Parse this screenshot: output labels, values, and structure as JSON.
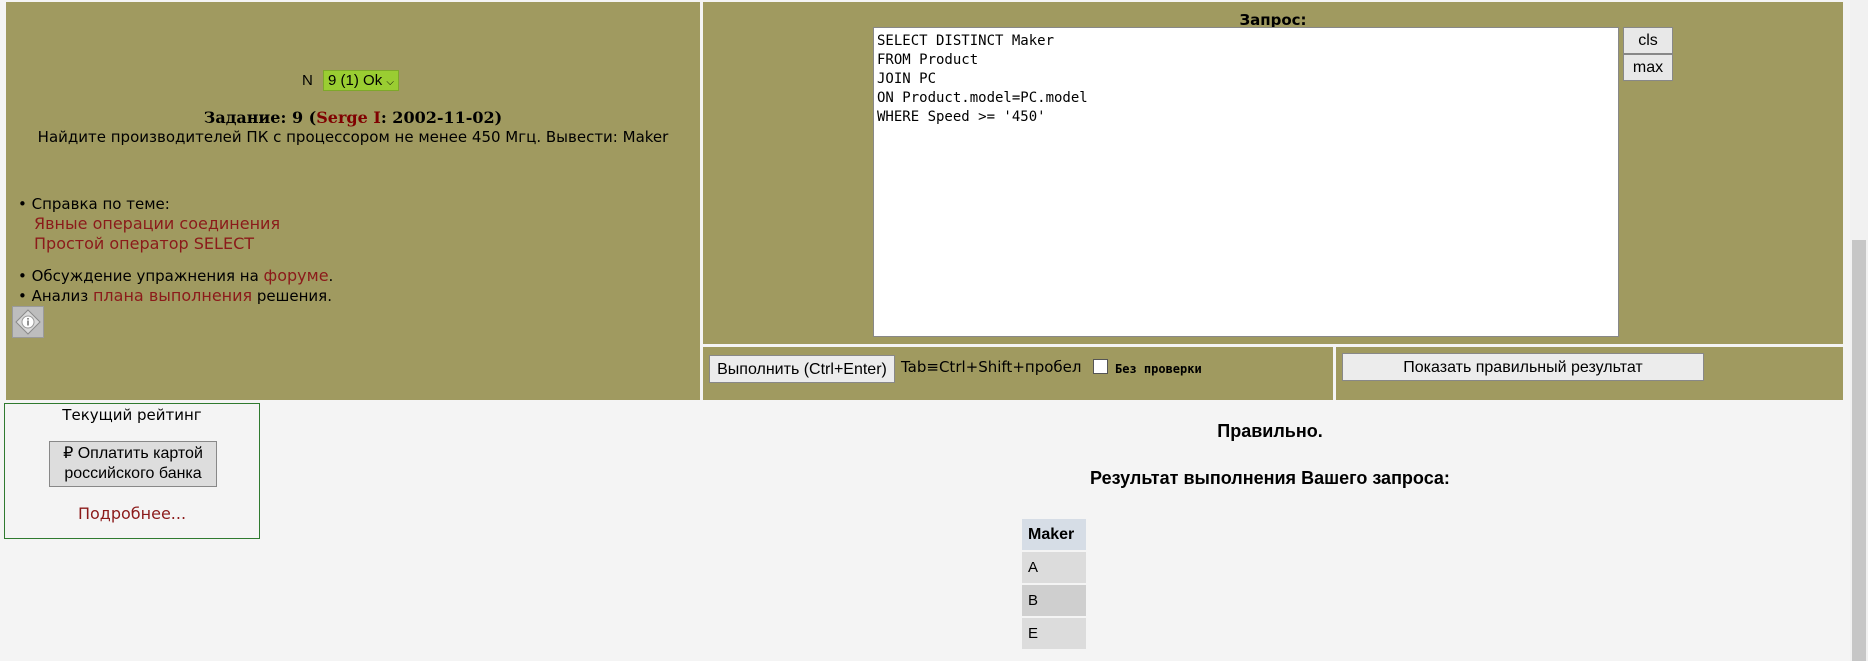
{
  "task": {
    "n_label": "N",
    "selector_value": "9 (1) Ok",
    "title_prefix": "Задание: 9 (",
    "author": "Serge I",
    "title_suffix": ": 2002-11-02)",
    "text": "Найдите производителей ПК с процессором не менее 450 Мгц. Вывести: Maker"
  },
  "help": {
    "label": "• Справка по теме:",
    "links": [
      "Явные операции соединения",
      "Простой оператор SELECT"
    ],
    "forum_prefix": "• Обсуждение упражнения на ",
    "forum_link": "форуме",
    "forum_suffix": ".",
    "plan_prefix": "• Анализ ",
    "plan_link": "плана выполнения",
    "plan_suffix": " решения."
  },
  "query": {
    "label": "Запрос:",
    "text": "SELECT DISTINCT Maker\nFROM Product\nJOIN PC\nON Product.model=PC.model\nWHERE Speed >= '450'",
    "cls_label": "cls",
    "max_label": "max"
  },
  "exec": {
    "button_label": "Выполнить (Ctrl+Enter)",
    "tab_hint": "Tab≡Ctrl+Shift+пробел",
    "nocheck_label": "Без проверки",
    "show_result_label": "Показать правильный результат"
  },
  "rating": {
    "title": "Текущий рейтинг",
    "pay_button": "₽ Оплатить картой российского банка",
    "more_link": "Подробнее..."
  },
  "result": {
    "status": "Правильно.",
    "title": "Результат выполнения Вашего запроса:",
    "columns": [
      "Maker"
    ],
    "rows": [
      [
        "A"
      ],
      [
        "B"
      ],
      [
        "E"
      ]
    ]
  }
}
